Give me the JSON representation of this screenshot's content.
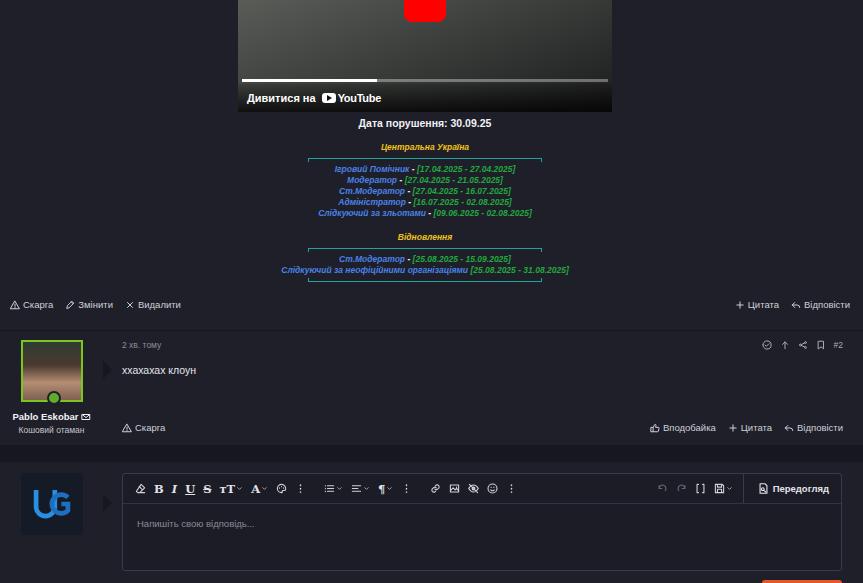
{
  "video": {
    "watch_label": "Дивитися на",
    "brand": "YouTube",
    "progress": 0.37
  },
  "violation_date": "Дата порушення: 30.09.25",
  "sections": [
    {
      "title": "Центральна Україна",
      "roles": [
        {
          "role": "Ігровий Помічник",
          "separator": " - ",
          "dates": "[17.04.2025 - 27.04.2025]"
        },
        {
          "role": "Модератор",
          "separator": " - ",
          "dates": "[27.04.2025 - 21.05.2025]"
        },
        {
          "role": "Ст.Модератор",
          "separator": " - ",
          "dates": "[27.04.2025 - 16.07.2025]"
        },
        {
          "role": "Адміністратор",
          "separator": " - ",
          "dates": "[16.07.2025 - 02.08.2025]"
        },
        {
          "role": "Слідкуючий за зльотами",
          "separator": " - ",
          "dates": "[09.06.2025 - 02.08.2025]"
        }
      ]
    },
    {
      "title": "Відновлення",
      "roles": [
        {
          "role": "Ст.Модератор",
          "separator": " - ",
          "dates": "[25.08.2025 - 15.09.2025]"
        },
        {
          "role": "Слідкуючий за неофіційними організаціями",
          "separator": " ",
          "dates": "[25.08.2025 - 31.08.2025]"
        }
      ]
    }
  ],
  "post_actions": {
    "left": [
      {
        "icon": "warning",
        "label": "Скарга"
      },
      {
        "icon": "edit",
        "label": "Змінити"
      },
      {
        "icon": "close",
        "label": "Видалити"
      }
    ],
    "right": [
      {
        "icon": "plus",
        "label": "Цитата"
      },
      {
        "icon": "reply",
        "label": "Відповісти"
      }
    ]
  },
  "reply_post": {
    "author": "Pablo Eskobar",
    "user_title": "Кошовий отаман",
    "online": true,
    "time": "2 хв. тому",
    "number": "#2",
    "header_icons": [
      "check-circle",
      "arrow-up",
      "share",
      "bookmark"
    ],
    "message": "ххахахах клоун",
    "left_actions": [
      {
        "icon": "warning",
        "label": "Скарга"
      }
    ],
    "right_actions": [
      {
        "icon": "like",
        "label": "Вподобайка"
      },
      {
        "icon": "plus",
        "label": "Цитата"
      },
      {
        "icon": "reply",
        "label": "Відповісти"
      }
    ]
  },
  "editor": {
    "placeholder": "Напишіть свою відповідь...",
    "preview_label": "Передогляд",
    "toolbar": [
      {
        "kind": "icon",
        "icon": "eraser",
        "dropdown": false,
        "group_end": false
      },
      {
        "kind": "bold",
        "text": "B",
        "dropdown": false,
        "group_end": false
      },
      {
        "kind": "italic",
        "text": "I",
        "dropdown": false,
        "group_end": false
      },
      {
        "kind": "underline",
        "text": "U",
        "dropdown": false,
        "group_end": false
      },
      {
        "kind": "strike",
        "text": "S",
        "dropdown": false,
        "group_end": false
      },
      {
        "kind": "plain",
        "text": "тT",
        "dropdown": true,
        "group_end": false
      },
      {
        "kind": "plain",
        "text": "A",
        "dropdown": true,
        "group_end": false
      },
      {
        "kind": "icon",
        "icon": "palette",
        "dropdown": false,
        "group_end": false
      },
      {
        "kind": "icon",
        "icon": "dots",
        "dropdown": false,
        "group_end": true
      },
      {
        "kind": "icon",
        "icon": "list",
        "dropdown": true,
        "group_end": false
      },
      {
        "kind": "icon",
        "icon": "align",
        "dropdown": true,
        "group_end": false
      },
      {
        "kind": "plain",
        "text": "¶",
        "dropdown": true,
        "group_end": false
      },
      {
        "kind": "icon",
        "icon": "dots",
        "dropdown": false,
        "group_end": true
      },
      {
        "kind": "icon",
        "icon": "link",
        "dropdown": false,
        "group_end": false
      },
      {
        "kind": "icon",
        "icon": "image",
        "dropdown": false,
        "group_end": false
      },
      {
        "kind": "icon",
        "icon": "eye-slash",
        "dropdown": false,
        "group_end": false
      },
      {
        "kind": "icon",
        "icon": "smile",
        "dropdown": false,
        "group_end": false
      },
      {
        "kind": "icon",
        "icon": "dots",
        "dropdown": false,
        "group_end": false
      }
    ],
    "toolbar_right": [
      {
        "icon": "undo",
        "disabled": true,
        "dropdown": false
      },
      {
        "icon": "redo",
        "disabled": true,
        "dropdown": false
      },
      {
        "icon": "brackets",
        "disabled": false,
        "dropdown": false
      },
      {
        "icon": "save",
        "disabled": false,
        "dropdown": true
      }
    ]
  }
}
